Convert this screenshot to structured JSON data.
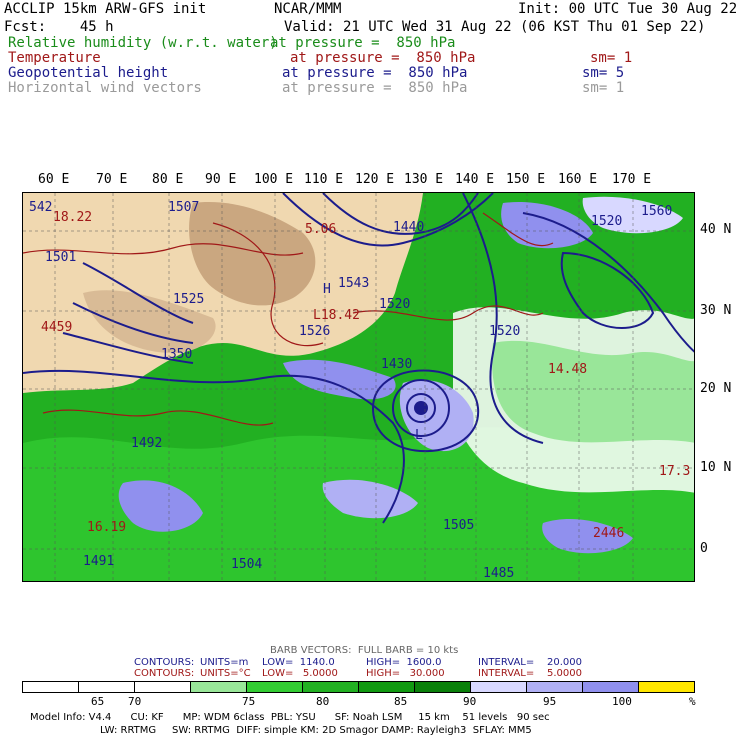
{
  "header": {
    "model": "ACCLIP 15km ARW-GFS init",
    "org": "NCAR/MMM",
    "init": "Init: 00 UTC Tue 30 Aug 22",
    "fcst": "Fcst:    45 h",
    "valid": "Valid: 21 UTC Wed 31 Aug 22 (06 KST Thu 01 Sep 22)"
  },
  "fields": [
    {
      "name": "Relative humidity (w.r.t. water)",
      "level": "at pressure =  850 hPa",
      "sm": "",
      "color": "#1a8c1a"
    },
    {
      "name": "Temperature",
      "level": "at pressure =  850 hPa",
      "sm": "sm= 1",
      "color": "#a01818"
    },
    {
      "name": "Geopotential height",
      "level": "at pressure =  850 hPa",
      "sm": "sm= 5",
      "color": "#1c1c8c"
    },
    {
      "name": "Horizontal wind vectors",
      "level": "at pressure =  850 hPa",
      "sm": "sm= 1",
      "color": "#9a9a9a"
    }
  ],
  "lon_labels": [
    "60 E",
    "70 E",
    "80 E",
    "90 E",
    "100 E",
    "110 E",
    "120 E",
    "130 E",
    "140 E",
    "150 E",
    "160 E",
    "170 E"
  ],
  "lat_labels": [
    "40 N",
    "30 N",
    "20 N",
    "10 N",
    "0"
  ],
  "map_labels": [
    {
      "text": "542",
      "color": "#1c1c8c"
    },
    {
      "text": "18.22",
      "color": "#a01818"
    },
    {
      "text": "1501",
      "color": "#1c1c8c"
    },
    {
      "text": "1507",
      "color": "#1c1c8c"
    },
    {
      "text": "1525",
      "color": "#1c1c8c"
    },
    {
      "text": "4459",
      "color": "#a01818"
    },
    {
      "text": "1350",
      "color": "#1c1c8c"
    },
    {
      "text": "5.06",
      "color": "#a01818"
    },
    {
      "text": "1543",
      "color": "#1c1c8c"
    },
    {
      "text": "L18.42",
      "color": "#a01818"
    },
    {
      "text": "1526",
      "color": "#1c1c8c"
    },
    {
      "text": "1440",
      "color": "#1c1c8c"
    },
    {
      "text": "1520",
      "color": "#1c1c8c"
    },
    {
      "text": "1520",
      "color": "#1c1c8c"
    },
    {
      "text": "1520",
      "color": "#1c1c8c"
    },
    {
      "text": "1560",
      "color": "#1c1c8c"
    },
    {
      "text": "1430",
      "color": "#1c1c8c"
    },
    {
      "text": "1492",
      "color": "#1c1c8c"
    },
    {
      "text": "14.48",
      "color": "#a01818"
    },
    {
      "text": "1505",
      "color": "#1c1c8c"
    },
    {
      "text": "1485",
      "color": "#1c1c8c"
    },
    {
      "text": "16.19",
      "color": "#a01818"
    },
    {
      "text": "1491",
      "color": "#1c1c8c"
    },
    {
      "text": "1504",
      "color": "#1c1c8c"
    },
    {
      "text": "2446",
      "color": "#a01818"
    },
    {
      "text": "17.3",
      "color": "#a01818"
    },
    {
      "text": "H",
      "color": "#1c1c8c"
    },
    {
      "text": "L",
      "color": "#1c1c8c"
    }
  ],
  "barb_note": "BARB VECTORS:  FULL BARB = 10 kts",
  "contours": [
    {
      "label": "CONTOURS:",
      "units": "UNITS=m",
      "low": "LOW=  1140.0",
      "high": "HIGH=  1600.0",
      "interval": "INTERVAL=    20.000"
    },
    {
      "label": "CONTOURS:",
      "units": "UNITS=°C",
      "low": "LOW=   5.0000",
      "high": "HIGH=   30.000",
      "interval": "INTERVAL=    5.0000"
    }
  ],
  "colorbar": {
    "colors": [
      "#ffffff",
      "#ffffff",
      "#ffffff",
      "#99e699",
      "#33cc33",
      "#22b022",
      "#119911",
      "#0a800a",
      "#d8d8ff",
      "#b0b0f4",
      "#9090ee",
      "#ffe600"
    ],
    "labels": [
      "65",
      "70",
      "75",
      "80",
      "85",
      "90",
      "95",
      "100",
      "%"
    ]
  },
  "footer": [
    "Model Info: V4.4      CU: KF      MP: WDM 6class  PBL: YSU      SF: Noah LSM     15 km    51 levels   90 sec",
    "LW: RRTMG     SW: RRTMG  DIFF: simple KM: 2D Smagor DAMP: Rayleigh3  SFLAY: MM5"
  ]
}
